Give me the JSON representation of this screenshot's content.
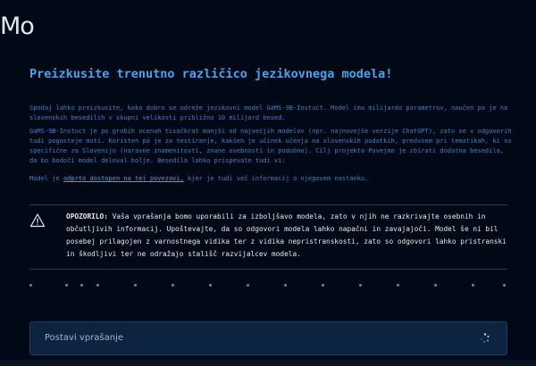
{
  "app": {
    "logo": "Mo"
  },
  "intro": {
    "heading": "Preizkusite trenutno različico jezikovnega modela!",
    "paragraph1": "Spodaj lahko preizkusite, kako dobro se odreže jezikovni model GaMS-9B-Instuct. Model ima milijardo parametrov, naučen pa je na slovenskih besedilih v skupni velikosti približno 10 milijard besed.",
    "paragraph2": "GaMS-9B-Instuct je po grobih ocenah tisočkrat manjši od največjih modelov (npr. najnovejše verzije ChatGPT), zato se v odgovorih tudi pogosteje moti. Koristen pa je za testiranje, kakšen je učinek učenja na slovenskih podatkih, predvsem pri tematikah, ki so specifične za Slovenijo (naravne znamenitosti, znane osebnosti in podobno). Cilj projekta Povejmo je zbirati dodatna besedila, da bo bodoči model deloval bolje. Besedila lahko prispevate tudi vi:",
    "paragraph3_before": "Model je ",
    "paragraph3_link": "odprto dostopen na tej povezavi,",
    "paragraph3_after": " kjer je tudi več informacij o njegovem nastanku."
  },
  "warning": {
    "icon": "warning-triangle-icon",
    "label": "OPOZORILO:",
    "text": " Vaša vprašanja bomo uporabili za izboljšavo modela, zato v njih ne razkrivajte osebnih in občutljivih informacij. Upoštevajte, da so odgovori modela lahko napačni in zavajajoči. Model še ni bil posebej prilagojen z varnostnega vidika ter z vidika nepristranskosti, zato so odgovori lahko pristranski in škodljivi ter ne odražajo stališč razvijalcev modela."
  },
  "ask": {
    "label": "Postavi vprašanje",
    "icon": "spinner-icon"
  },
  "colors": {
    "background": "#020916",
    "accent": "#4aa3e8",
    "button_bg": "#0c2440"
  }
}
